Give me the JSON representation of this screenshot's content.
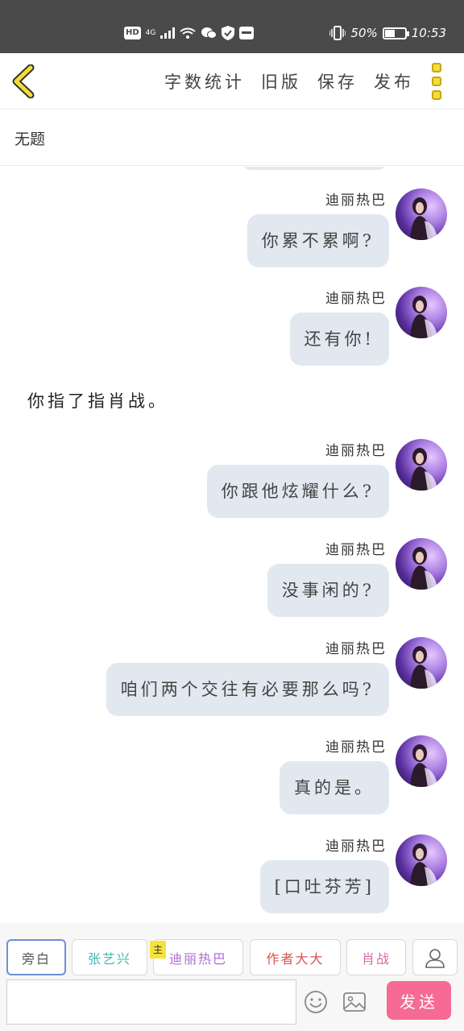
{
  "status_bar": {
    "hd": "HD",
    "network": "4G",
    "battery_text": "50%",
    "battery_level": 0.5,
    "time": "10:53"
  },
  "toolbar": {
    "word_count": "字数统计",
    "old_version": "旧版",
    "save": "保存",
    "publish": "发布"
  },
  "title": "无题",
  "messages": [
    {
      "sender": "迪丽热巴",
      "text": "你累不累啊?"
    },
    {
      "sender": "迪丽热巴",
      "text": "还有你!"
    },
    {
      "sender": "迪丽热巴",
      "text": "你跟他炫耀什么?"
    },
    {
      "sender": "迪丽热巴",
      "text": "没事闲的?"
    },
    {
      "sender": "迪丽热巴",
      "text": "咱们两个交往有必要那么吗?"
    },
    {
      "sender": "迪丽热巴",
      "text": "真的是。"
    },
    {
      "sender": "迪丽热巴",
      "text": "[口吐芬芳]"
    }
  ],
  "narration": "你指了指肖战。",
  "roles": [
    {
      "label": "旁白",
      "color": "#555555"
    },
    {
      "label": "张艺兴",
      "color": "#3fb8b0"
    },
    {
      "label": "迪丽热巴",
      "color": "#b06ad6"
    },
    {
      "label": "作者大大",
      "color": "#d9534f"
    },
    {
      "label": "肖战",
      "color": "#d66aa8"
    }
  ],
  "main_tag": "主",
  "input": {
    "value": "",
    "placeholder": ""
  },
  "send_label": "发送",
  "colors": {
    "accent": "#f6dc33",
    "bubble": "#e2e8ef",
    "send": "#f56b96"
  }
}
